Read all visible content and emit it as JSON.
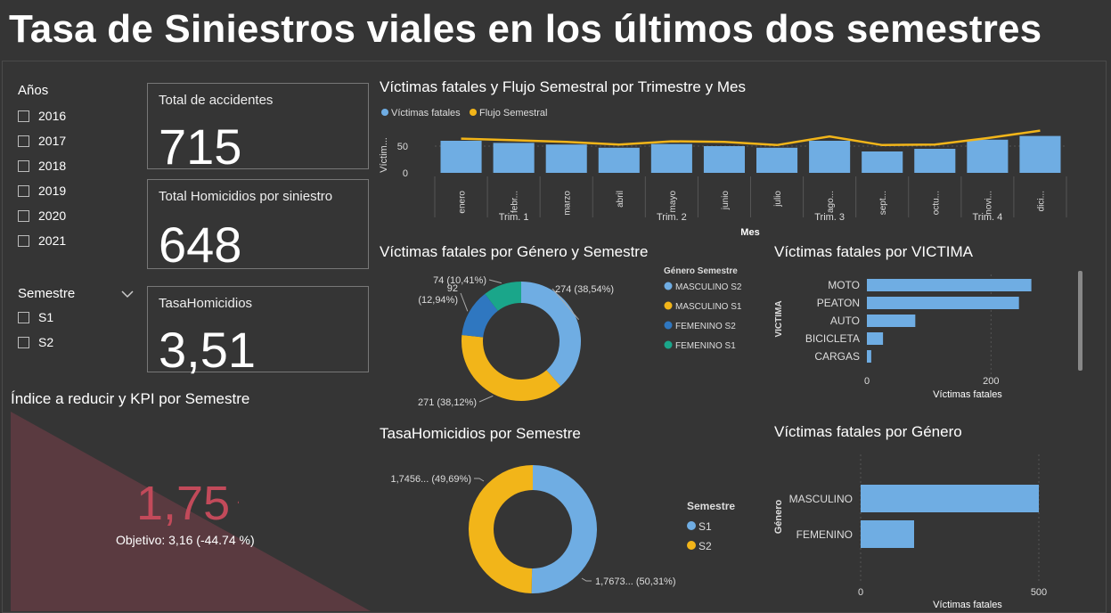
{
  "page": {
    "title": "Tasa de Siniestros viales en los últimos dos semestres"
  },
  "years_slicer": {
    "title": "Años",
    "items": [
      "2016",
      "2017",
      "2018",
      "2019",
      "2020",
      "2021"
    ]
  },
  "semester_slicer": {
    "title": "Semestre",
    "items": [
      "S1",
      "S2"
    ]
  },
  "cards": [
    {
      "label": "Total de accidentes",
      "value": "715"
    },
    {
      "label": "Total Homicidios por siniestro",
      "value": "648"
    },
    {
      "label": "TasaHomicidios",
      "value": "3,51"
    }
  ],
  "kpi": {
    "title": "Índice a reducir y KPI por Semestre",
    "value": "1,75",
    "target_text": "Objetivo: 3,16 (-44.74 %)",
    "color": "#c24a5a"
  },
  "colors": {
    "blue": "#6fade3",
    "yellow": "#f2b519",
    "dark_blue": "#2f77c0",
    "teal": "#1aa68a",
    "kpi_bg": "#5a3a40"
  },
  "chart_data": [
    {
      "id": "monthly",
      "type": "bar",
      "title": "Víctimas fatales y Flujo Semestral por Trimestre y Mes",
      "ylabel": "Víctim...",
      "xlabel": "Mes",
      "categories": [
        "enero",
        "febr...",
        "marzo",
        "abril",
        "mayo",
        "junio",
        "julio",
        "ago...",
        "sept...",
        "octu...",
        "novi...",
        "dici..."
      ],
      "quarters": [
        "Trim. 1",
        "Trim. 2",
        "Trim. 3",
        "Trim. 4"
      ],
      "y_ticks": [
        0,
        50
      ],
      "ylim": [
        0,
        85
      ],
      "legend": [
        "Víctimas fatales",
        "Flujo Semestral"
      ],
      "series": [
        {
          "name": "Víctimas fatales",
          "values": [
            60,
            56,
            53,
            47,
            54,
            50,
            47,
            60,
            40,
            45,
            62,
            69
          ]
        },
        {
          "name": "Flujo Semestral",
          "values": [
            64,
            61,
            58,
            53,
            59,
            58,
            52,
            68,
            52,
            53,
            65,
            79
          ]
        }
      ]
    },
    {
      "id": "genero_semestre",
      "type": "pie",
      "title": "Víctimas fatales por Género y Semestre",
      "legend_title": "Género Semestre",
      "labels": [
        "MASCULINO S2",
        "MASCULINO S1",
        "FEMENINO S2",
        "FEMENINO S1"
      ],
      "values": [
        274,
        271,
        92,
        74
      ],
      "data_labels": [
        "274 (38,54%)",
        "271 (38,12%)",
        "92\n(12,94%)",
        "74 (10,41%)"
      ]
    },
    {
      "id": "victima",
      "type": "bar",
      "orientation": "horizontal",
      "title": "Víctimas fatales por VICTIMA",
      "ylabel": "VICTIMA",
      "xlabel": "Víctimas fatales",
      "categories": [
        "MOTO",
        "PEATON",
        "AUTO",
        "BICICLETA",
        "CARGAS"
      ],
      "values": [
        265,
        245,
        78,
        26,
        7
      ],
      "x_ticks": [
        0,
        200
      ],
      "xlim": [
        0,
        300
      ]
    },
    {
      "id": "tasa_semestre",
      "type": "pie",
      "title": "TasaHomicidios por Semestre",
      "legend_title": "Semestre",
      "labels": [
        "S1",
        "S2"
      ],
      "values": [
        1.7673,
        1.7456
      ],
      "data_labels": [
        "1,7673... (50,31%)",
        "1,7456... (49,69%)"
      ]
    },
    {
      "id": "genero",
      "type": "bar",
      "orientation": "horizontal",
      "title": "Víctimas fatales por Género",
      "ylabel": "Género",
      "xlabel": "Víctimas fatales",
      "categories": [
        "MASCULINO",
        "FEMENINO"
      ],
      "values": [
        500,
        150
      ],
      "x_ticks": [
        0,
        500
      ],
      "xlim": [
        0,
        500
      ]
    }
  ]
}
